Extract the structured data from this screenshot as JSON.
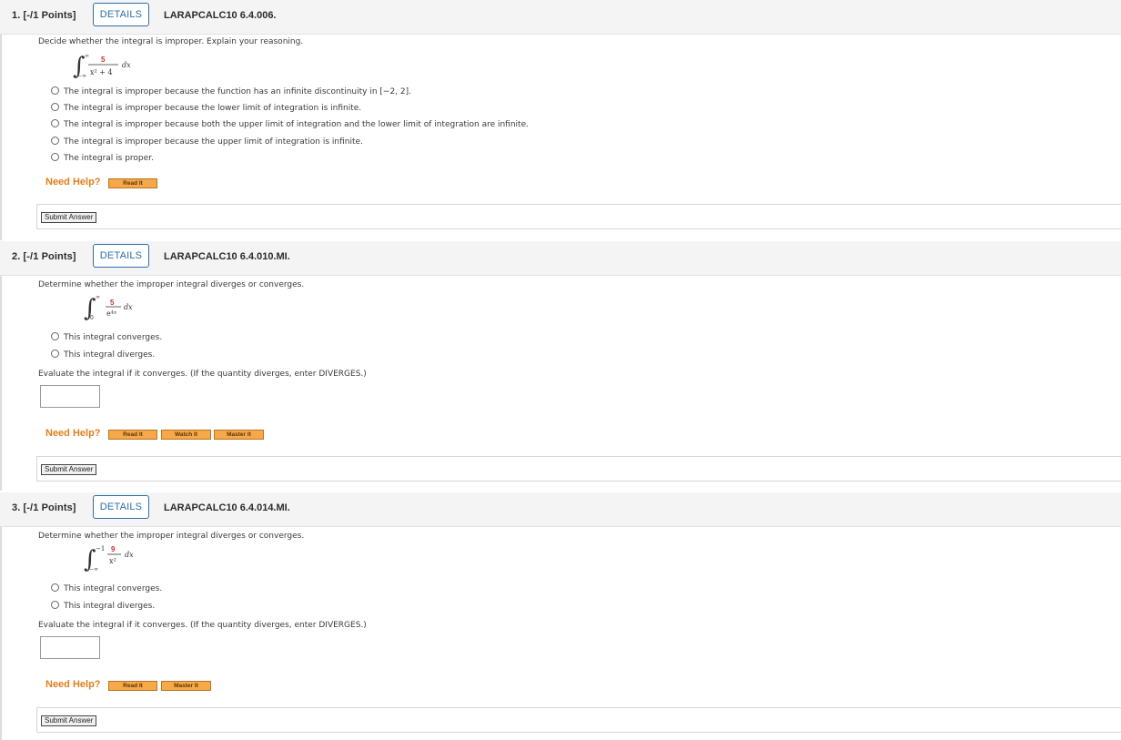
{
  "questions": [
    {
      "number": "1. [-/1 Points]",
      "details_label": "DETAILS",
      "id": "LARAPCALC10 6.4.006.",
      "prompt": "Decide whether the integral is improper. Explain your reasoning.",
      "integral": {
        "upper": "∞",
        "lower": "−∞",
        "numerator": "5",
        "denominator": "x² + 4",
        "dx": "dx"
      },
      "options": [
        "The integral is improper because the function has an infinite discontinuity in [−2, 2].",
        "The integral is improper because the lower limit of integration is infinite.",
        "The integral is improper because both the upper limit of integration and the lower limit of integration are infinite.",
        "The integral is improper because the upper limit of integration is infinite.",
        "The integral is proper."
      ],
      "need_help": "Need Help?",
      "help_buttons": [
        "Read It"
      ],
      "submit_label": "Submit Answer"
    },
    {
      "number": "2. [-/1 Points]",
      "details_label": "DETAILS",
      "id": "LARAPCALC10 6.4.010.MI.",
      "prompt": "Determine whether the improper integral diverges or converges.",
      "integral": {
        "upper": "∞",
        "lower": "0",
        "numerator": "5",
        "denominator": "e⁴ˣ",
        "dx": "dx"
      },
      "options": [
        "This integral converges.",
        "This integral diverges."
      ],
      "evaluate_prompt": "Evaluate the integral if it converges. (If the quantity diverges, enter DIVERGES.)",
      "answer_value": "",
      "need_help": "Need Help?",
      "help_buttons": [
        "Read It",
        "Watch It",
        "Master It"
      ],
      "submit_label": "Submit Answer"
    },
    {
      "number": "3. [-/1 Points]",
      "details_label": "DETAILS",
      "id": "LARAPCALC10 6.4.014.MI.",
      "prompt": "Determine whether the improper integral diverges or converges.",
      "integral": {
        "upper": "−1",
        "lower": "−∞",
        "numerator": "9",
        "denominator": "x²",
        "dx": "dx"
      },
      "options": [
        "This integral converges.",
        "This integral diverges."
      ],
      "evaluate_prompt": "Evaluate the integral if it converges. (If the quantity diverges, enter DIVERGES.)",
      "answer_value": "",
      "need_help": "Need Help?",
      "help_buttons": [
        "Read It",
        "Master It"
      ],
      "submit_label": "Submit Answer"
    }
  ],
  "colors": {
    "details_border": "#2d6fa8",
    "need_help": "#e07e1b",
    "help_button_bg": "#f7a94a",
    "header_bg": "#f4f4f4",
    "numerator_red": "#c9302c"
  }
}
